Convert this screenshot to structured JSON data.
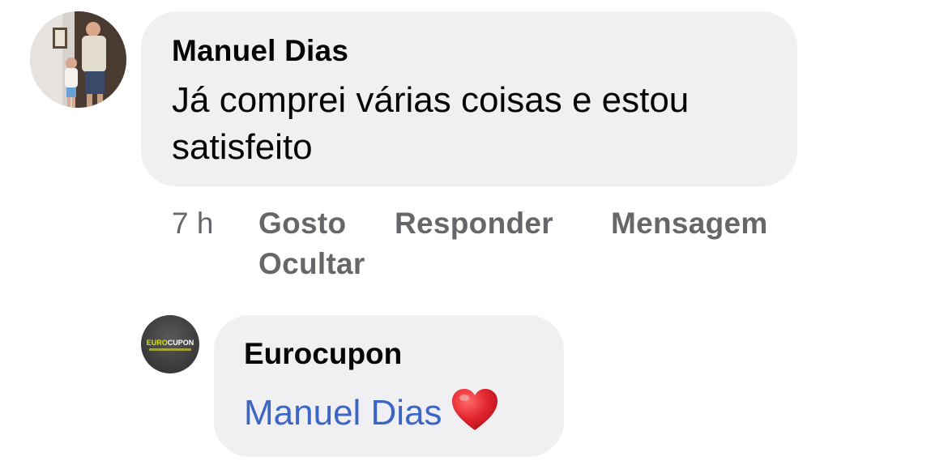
{
  "comment": {
    "author": "Manuel Dias",
    "text": "Já comprei várias coisas e estou satisfeito",
    "timestamp": "7 h",
    "actions": {
      "like": "Gosto",
      "reply": "Responder",
      "message": "Mensagem",
      "hide": "Ocultar"
    }
  },
  "reply": {
    "author": "Eurocupon",
    "mention": "Manuel Dias",
    "emoji": "heart-icon",
    "avatar_logo": {
      "part1": "EURO",
      "part2": "CUPON"
    }
  },
  "colors": {
    "bubble": "#f0f0f3",
    "mention": "#3b66c5",
    "meta": "#65676b",
    "heart": "#e0242f"
  }
}
